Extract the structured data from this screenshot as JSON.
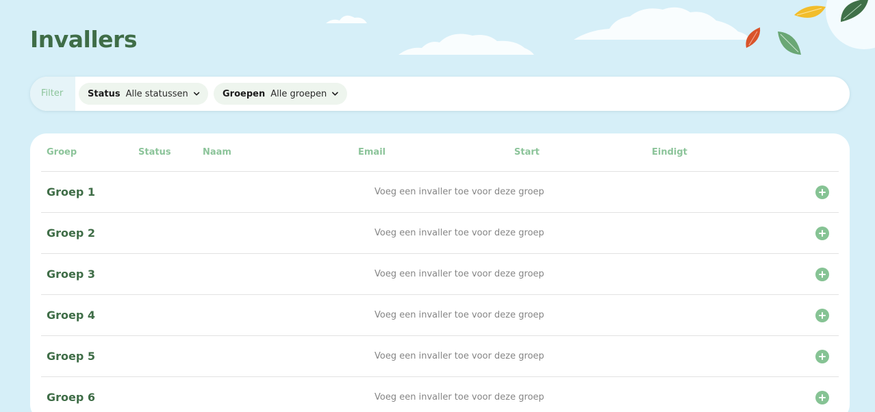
{
  "page": {
    "title": "Invallers"
  },
  "filter": {
    "label": "Filter",
    "status": {
      "key": "Status",
      "value": "Alle statussen"
    },
    "groups": {
      "key": "Groepen",
      "value": "Alle groepen"
    }
  },
  "table": {
    "columns": [
      "Groep",
      "Status",
      "Naam",
      "Email",
      "Start",
      "Eindigt"
    ],
    "rows": [
      {
        "group": "Groep 1",
        "text": "Voeg een invaller toe voor deze groep"
      },
      {
        "group": "Groep 2",
        "text": "Voeg een invaller toe voor deze groep"
      },
      {
        "group": "Groep 3",
        "text": "Voeg een invaller toe voor deze groep"
      },
      {
        "group": "Groep 4",
        "text": "Voeg een invaller toe voor deze groep"
      },
      {
        "group": "Groep 5",
        "text": "Voeg een invaller toe voor deze groep"
      },
      {
        "group": "Groep 6",
        "text": "Voeg een invaller toe voor deze groep"
      }
    ]
  },
  "icons": {
    "filter_chevron": "chevron-down-icon",
    "row_action": "plus-circle-icon"
  },
  "colors": {
    "background": "#d6eff8",
    "title": "#3f6d47",
    "accent": "#86c394",
    "header_text": "#8cc49a"
  }
}
